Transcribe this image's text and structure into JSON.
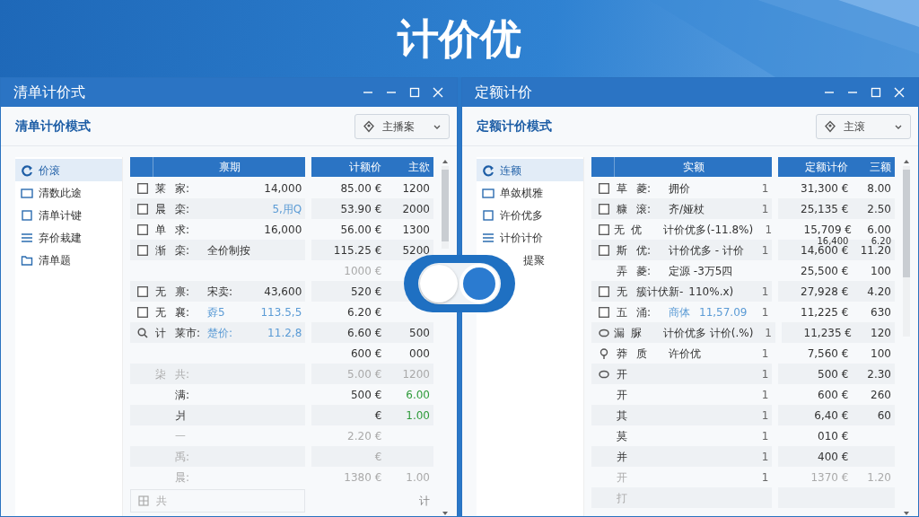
{
  "banner": {
    "title": "计价优"
  },
  "toggle": {
    "on": true
  },
  "windows": [
    {
      "title": "清单计价式",
      "mode_title": "清单计价模式",
      "dropdown": {
        "label": "主播案"
      },
      "sidebar": [
        {
          "kind": "refresh",
          "label": "价滚",
          "selected": true
        },
        {
          "kind": "window",
          "label": "清数此途",
          "selected": false
        },
        {
          "kind": "square",
          "label": "清单计键",
          "selected": false
        },
        {
          "kind": "list",
          "label": "弃价栽建",
          "selected": false
        },
        {
          "kind": "folder",
          "label": "清单题",
          "selected": false
        }
      ],
      "columns": [
        "禀期",
        "计额价",
        "主欲"
      ],
      "rows": [
        {
          "kind": "box",
          "checked": false,
          "c1": "莱",
          "c2": "家:",
          "value": "14,000",
          "price": "85.00 €",
          "qty": "1200",
          "faded": false
        },
        {
          "kind": "box",
          "checked": false,
          "c1": "晨",
          "c2": "栾:",
          "value": "5,用Q",
          "price": "53.90 €",
          "qty": "2000",
          "color": "#5b9bd5",
          "faded": false
        },
        {
          "kind": "box",
          "checked": false,
          "c1": "单",
          "c2": "求:",
          "value": "16,000",
          "price": "56.00 €",
          "qty": "1300",
          "faded": false
        },
        {
          "kind": "box",
          "checked": false,
          "c1": "渐",
          "c2": "栾:",
          "text": "全价制按",
          "price": "115.25 €",
          "qty": "5200",
          "faded": false
        },
        {
          "kind": "plain",
          "price": "1000 €",
          "faded": true
        },
        {
          "kind": "box",
          "checked": false,
          "c1": "无",
          "c2": "禀:",
          "text": "宋卖:",
          "value": "43,600",
          "price": "520 €",
          "faded": false
        },
        {
          "kind": "box",
          "checked": false,
          "c1": "无",
          "c2": "襄:",
          "text": "孬5",
          "value": "113.5,5",
          "price": "6.20 €",
          "color": "#5b9bd5",
          "faded": false
        },
        {
          "kind": "search",
          "c1": "计",
          "c2": "莱市:",
          "text": "楚价:",
          "value": "11.2,8",
          "price": "6.60 €",
          "qty": "500",
          "color": "#5b9bd5",
          "faded": false
        },
        {
          "kind": "plain",
          "price": "600 €",
          "qty": "000",
          "faded": false
        },
        {
          "kind": "plain",
          "c1": "柒",
          "c2": "共:",
          "price": "5.00 €",
          "qty": "1200",
          "faded": true
        },
        {
          "kind": "plain",
          "c2": "满:",
          "price": "500 €",
          "qty": "6.00",
          "color": "#2e9b3a",
          "faded": false
        },
        {
          "kind": "plain",
          "c2": "爿",
          "price": "€",
          "qty": "1.00",
          "color": "#2e9b3a",
          "faded": false
        },
        {
          "kind": "plain",
          "c2": "一",
          "price": "2.20 €",
          "faded": true
        },
        {
          "kind": "plain",
          "c2": "禹:",
          "price": "€",
          "faded": true
        },
        {
          "kind": "plain",
          "c2": "晨:",
          "price": "1380 €",
          "qty": "1.00",
          "faded": true
        }
      ],
      "footer": {
        "label": "共",
        "total": "计"
      }
    },
    {
      "title": "定额计价",
      "mode_title": "定额计价模式",
      "dropdown": {
        "label": "主滚"
      },
      "sidebar": [
        {
          "kind": "refresh",
          "label": "连额",
          "selected": true
        },
        {
          "kind": "window",
          "label": "单敛棋雅",
          "selected": false
        },
        {
          "kind": "square",
          "label": "许价优多",
          "selected": false
        },
        {
          "kind": "list",
          "label": "计价计价",
          "selected": false
        },
        {
          "kind": "covered",
          "label": "提聚",
          "selected": false
        }
      ],
      "columns": [
        "实额",
        "定额计价",
        "三额"
      ],
      "rows": [
        {
          "kind": "box",
          "checked": false,
          "c1": "草",
          "c2": "菱:",
          "text": "拥价",
          "count": "1",
          "price": "31,300 €",
          "qty": "8.00",
          "faded": false
        },
        {
          "kind": "box",
          "checked": false,
          "c1": "糠",
          "c2": "滚:",
          "text": "齐/娅杖",
          "count": "1",
          "price": "25,135 €",
          "qty": "2.50",
          "faded": false
        },
        {
          "kind": "box",
          "checked": false,
          "c1": "无",
          "c2": "优",
          "text": "计价优多(-11.8%)",
          "count": "1",
          "price": "15,709 €",
          "qty": "6.00",
          "faded": false
        },
        {
          "kind": "box",
          "checked": false,
          "c1": "斯",
          "c2": "优:",
          "text": "计价优多 - 计价",
          "count": "1",
          "price_note": "16,400",
          "price": "14,600 €",
          "qty_note": "6.20",
          "qty": "11.20",
          "faded": false
        },
        {
          "kind": "plain",
          "c1": "弄",
          "c2": "菱:",
          "text": "定源 -3万5四",
          "price": "25,500 €",
          "qty": "100",
          "faded": false
        },
        {
          "kind": "box",
          "checked": false,
          "c1": "无",
          "c2": "簇计伏新-",
          "text": "110%.x)",
          "count": "1",
          "price": "27,928 €",
          "qty": "4.20",
          "faded": false
        },
        {
          "kind": "box",
          "checked": false,
          "c1": "五",
          "c2": "涌:",
          "text": "商体",
          "value": "11,57.09",
          "count": "1",
          "price": "11,225 €",
          "qty": "630",
          "color": "#5b9bd5",
          "faded": false
        },
        {
          "kind": "circle",
          "c1": "漏",
          "c2": "脲",
          "text": "计价优多 计价(.%)",
          "count": "1",
          "price": "11,235 €",
          "qty": "120",
          "faded": false
        },
        {
          "kind": "pin",
          "c1": "莽",
          "c2": "质",
          "text": "许价优",
          "count": "1",
          "price": "7,560 €",
          "qty": "100",
          "faded": false
        },
        {
          "kind": "circle",
          "c1": "开",
          "count": "1",
          "price": "500 €",
          "qty": "2.30",
          "faded": false
        },
        {
          "kind": "plain",
          "c1": "开",
          "count": "1",
          "price": "600 €",
          "qty": "260",
          "faded": false
        },
        {
          "kind": "plain",
          "c1": "其",
          "count": "1",
          "price": "6,40 €",
          "qty": "60",
          "faded": false
        },
        {
          "kind": "plain",
          "c1": "莫",
          "count": "1",
          "price": "010 €",
          "faded": false
        },
        {
          "kind": "plain",
          "c1": "并",
          "count": "1",
          "price": "400 €",
          "faded": false
        },
        {
          "kind": "plain",
          "c1": "开",
          "count": "1",
          "price": "1370 €",
          "qty": "1.20",
          "faded": true
        },
        {
          "kind": "plain",
          "c1": "打",
          "faded": true
        }
      ]
    }
  ]
}
